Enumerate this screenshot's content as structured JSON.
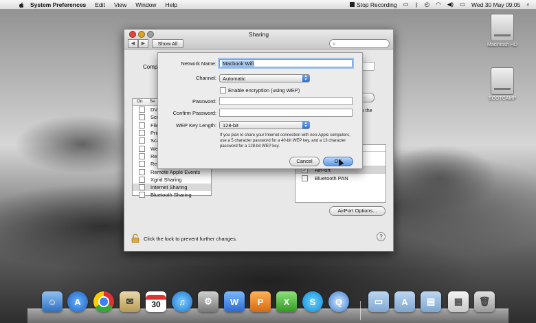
{
  "menubar": {
    "app_name": "System Preferences",
    "items": [
      "Edit",
      "View",
      "Window",
      "Help"
    ],
    "stop_recording": "Stop Recording",
    "datetime": "Wed 30 May  09:05"
  },
  "window": {
    "title": "Sharing",
    "show_all": "Show All",
    "computer_name_label": "Comp",
    "service_list": {
      "header_on": "On",
      "header_service": "Se",
      "rows": [
        {
          "label": "DV",
          "checked": false
        },
        {
          "label": "Scr",
          "checked": false
        },
        {
          "label": "File",
          "checked": false
        },
        {
          "label": "Prin",
          "checked": false
        },
        {
          "label": "Sca",
          "checked": false
        },
        {
          "label": "We",
          "checked": false
        },
        {
          "label": "Re",
          "checked": false
        },
        {
          "label": "Re",
          "checked": false
        },
        {
          "label": "Remote Apple Events",
          "checked": false
        },
        {
          "label": "Xgrid Sharing",
          "checked": false
        },
        {
          "label": "Internet Sharing",
          "checked": false,
          "selected": true
        },
        {
          "label": "Bluetooth Sharing",
          "checked": false
        }
      ]
    },
    "to_the": "to the",
    "side_button": "t...",
    "ports": {
      "rows": [
        {
          "label": "AirPort",
          "checked": true,
          "selected": true
        },
        {
          "label": "Bluetooth PAN",
          "checked": false
        }
      ]
    },
    "airport_options": "AirPort Options...",
    "lock_text": "Click the lock to prevent further changes."
  },
  "sheet": {
    "network_name_label": "Network Name:",
    "network_name_value": "Macbook Wifi",
    "channel_label": "Channel:",
    "channel_value": "Automatic",
    "encryption_label": "Enable encryption (using WEP)",
    "password_label": "Password:",
    "confirm_label": "Confirm Password:",
    "wep_label": "WEP Key Length:",
    "wep_value": "128-bit",
    "note": "If you plan to share your Internet connection with non-Apple computers, use a 5 character password for a 40-bit WEP key, and a 13 character password for a 128-bit WEP key.",
    "cancel": "Cancel",
    "ok": "OK"
  },
  "desktop": {
    "drives": [
      "Macintosh HD",
      "BOOTCAMP"
    ]
  },
  "dock": {
    "calendar_day": "30"
  }
}
